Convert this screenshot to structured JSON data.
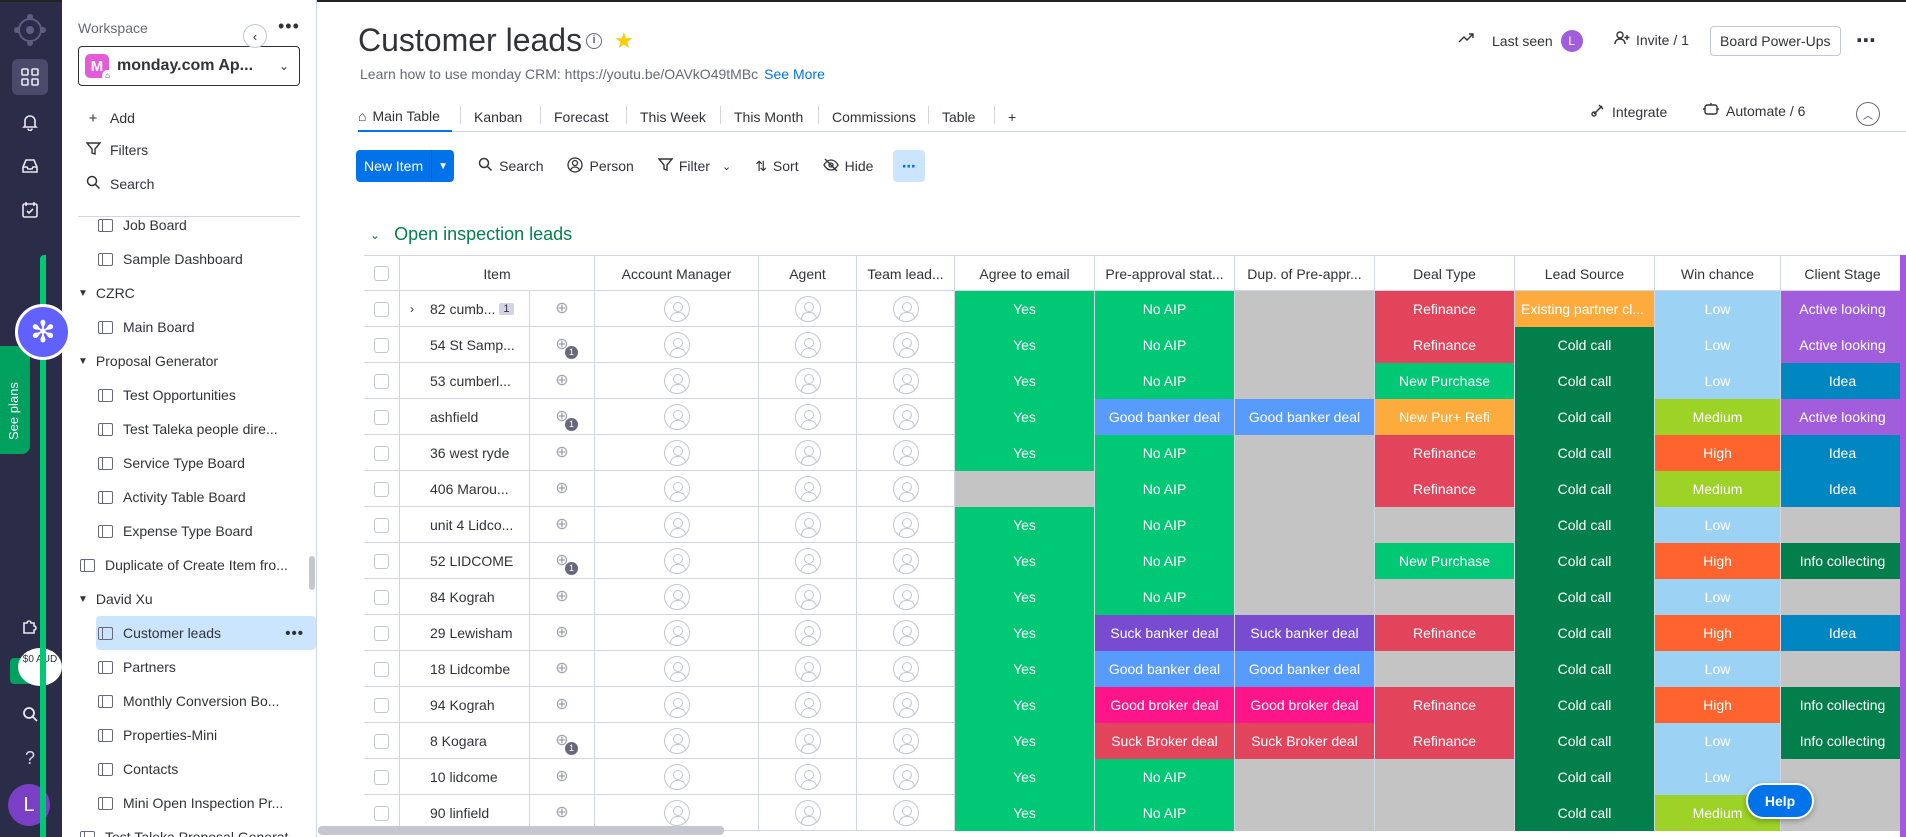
{
  "rail": {
    "icons": [
      "monday-logo-icon",
      "grid-icon",
      "bell-icon",
      "inbox-icon",
      "calendar-check-icon",
      "puzzle-icon",
      "search-icon",
      "help-icon"
    ],
    "wallet_badge": "$0 AUD",
    "avatar": "L"
  },
  "see_plans": "See plans",
  "workspace": {
    "label": "Workspace",
    "badge": "M",
    "name": "monday.com Ap...",
    "actions": {
      "add": "Add",
      "filters": "Filters",
      "search": "Search"
    }
  },
  "tree": [
    {
      "label": "Job Board",
      "type": "board"
    },
    {
      "label": "Sample Dashboard",
      "type": "dashboard"
    },
    {
      "label": "CZRC",
      "type": "folder"
    },
    {
      "label": "Main Board",
      "type": "board"
    },
    {
      "label": "Proposal Generator",
      "type": "folder"
    },
    {
      "label": "Test Opportunities",
      "type": "board"
    },
    {
      "label": "Test Taleka people dire...",
      "type": "board"
    },
    {
      "label": "Service Type Board",
      "type": "board"
    },
    {
      "label": "Activity Table Board",
      "type": "board"
    },
    {
      "label": "Expense Type Board",
      "type": "board"
    },
    {
      "label": "Duplicate of Create Item fro...",
      "type": "board"
    },
    {
      "label": "David Xu",
      "type": "folder"
    },
    {
      "label": "Customer leads",
      "type": "board",
      "selected": true
    },
    {
      "label": "Partners",
      "type": "board"
    },
    {
      "label": "Monthly Conversion Bo...",
      "type": "board"
    },
    {
      "label": "Properties-Mini",
      "type": "board"
    },
    {
      "label": "Contacts",
      "type": "board"
    },
    {
      "label": "Mini Open Inspection Pr...",
      "type": "board"
    },
    {
      "label": "Test Taleka Proposal Generat...",
      "type": "board"
    }
  ],
  "header": {
    "title": "Customer leads",
    "subtitle": "Learn how to use monday CRM: https://youtu.be/OAVkO49tMBc",
    "see_more": "See More",
    "last_seen": "Last seen",
    "last_seen_avatar": "L",
    "invite": "Invite / 1",
    "powerups": "Board Power-Ups"
  },
  "tabs": [
    "Main Table",
    "Kanban",
    "Forecast",
    "This Week",
    "This Month",
    "Commissions",
    "Table",
    "+"
  ],
  "tab_actions": {
    "integrate": "Integrate",
    "automate": "Automate / 6"
  },
  "toolbar": {
    "new_item": "New Item",
    "search": "Search",
    "person": "Person",
    "filter": "Filter",
    "sort": "Sort",
    "hide": "Hide"
  },
  "group": {
    "title": "Open inspection leads",
    "color": "#00c875"
  },
  "columns": [
    "Item",
    "Account Manager",
    "Agent",
    "Team lead...",
    "Agree to email",
    "Pre-approval stat...",
    "Dup. of Pre-appr...",
    "Deal Type",
    "Lead Source",
    "Win chance",
    "Client Stage"
  ],
  "status_colors": {
    "Yes": "#00c875",
    "No AIP": "#00c875",
    "Good banker deal": "#579bfc",
    "Suck banker deal": "#784bd1",
    "Good broker deal": "#ff158a",
    "Suck Broker deal": "#e2445c",
    "Refinance": "#e2445c",
    "New Purchase": "#00c875",
    "New Pur+ Refi": "#fdab3d",
    "Existing partner cl...": "#fdab3d",
    "Cold call": "#037f4c",
    "Low": "#9cd3f5",
    "Medium": "#9cd326",
    "High": "#ff642e",
    "Active looking": "#a25ddc",
    "Idea": "#0086c0",
    "Info collecting": "#037f4c",
    "": "#c4c4c4"
  },
  "rows": [
    {
      "item": "82 cumb...",
      "count": "1",
      "updates": "",
      "agree": "Yes",
      "preapp": "No AIP",
      "dup": "",
      "deal": "Refinance",
      "source": "Existing partner cl...",
      "win": "Low",
      "stage": "Active looking"
    },
    {
      "item": "54 St Samp...",
      "updates": "1",
      "agree": "Yes",
      "preapp": "No AIP",
      "dup": "",
      "deal": "Refinance",
      "source": "Cold call",
      "win": "Low",
      "stage": "Active looking"
    },
    {
      "item": "53 cumberl...",
      "updates": "",
      "agree": "Yes",
      "preapp": "No AIP",
      "dup": "",
      "deal": "New Purchase",
      "source": "Cold call",
      "win": "Low",
      "stage": "Idea"
    },
    {
      "item": "ashfield",
      "updates": "1",
      "agree": "Yes",
      "preapp": "Good banker deal",
      "dup": "Good banker deal",
      "deal": "New Pur+ Refi",
      "source": "Cold call",
      "win": "Medium",
      "stage": "Active looking"
    },
    {
      "item": "36 west ryde",
      "updates": "",
      "agree": "Yes",
      "preapp": "No AIP",
      "dup": "",
      "deal": "Refinance",
      "source": "Cold call",
      "win": "High",
      "stage": "Idea"
    },
    {
      "item": "406 Marou...",
      "updates": "",
      "agree": "",
      "preapp": "No AIP",
      "dup": "",
      "deal": "Refinance",
      "source": "Cold call",
      "win": "Medium",
      "stage": "Idea"
    },
    {
      "item": "unit 4 Lidco...",
      "updates": "",
      "agree": "Yes",
      "preapp": "No AIP",
      "dup": "",
      "deal": "",
      "source": "Cold call",
      "win": "Low",
      "stage": ""
    },
    {
      "item": "52 LIDCOME",
      "updates": "1",
      "agree": "Yes",
      "preapp": "No AIP",
      "dup": "",
      "deal": "New Purchase",
      "source": "Cold call",
      "win": "High",
      "stage": "Info collecting"
    },
    {
      "item": "84 Kograh",
      "updates": "",
      "agree": "Yes",
      "preapp": "No AIP",
      "dup": "",
      "deal": "",
      "source": "Cold call",
      "win": "Low",
      "stage": ""
    },
    {
      "item": "29 Lewisham",
      "updates": "",
      "agree": "Yes",
      "preapp": "Suck banker deal",
      "dup": "Suck banker deal",
      "deal": "Refinance",
      "source": "Cold call",
      "win": "High",
      "stage": "Idea"
    },
    {
      "item": "18 Lidcombe",
      "updates": "",
      "agree": "Yes",
      "preapp": "Good banker deal",
      "dup": "Good banker deal",
      "deal": "",
      "source": "Cold call",
      "win": "Low",
      "stage": ""
    },
    {
      "item": "94 Kograh",
      "updates": "",
      "agree": "Yes",
      "preapp": "Good broker deal",
      "dup": "Good broker deal",
      "deal": "Refinance",
      "source": "Cold call",
      "win": "High",
      "stage": "Info collecting"
    },
    {
      "item": "8 Kogara",
      "updates": "1",
      "agree": "Yes",
      "preapp": "Suck Broker deal",
      "dup": "Suck Broker deal",
      "deal": "Refinance",
      "source": "Cold call",
      "win": "Low",
      "stage": "Info collecting"
    },
    {
      "item": "10 lidcome",
      "updates": "",
      "agree": "Yes",
      "preapp": "No AIP",
      "dup": "",
      "deal": "",
      "source": "Cold call",
      "win": "Low",
      "stage": ""
    },
    {
      "item": "90 linfield",
      "updates": "",
      "agree": "Yes",
      "preapp": "No AIP",
      "dup": "",
      "deal": "",
      "source": "Cold call",
      "win": "Medium",
      "stage": ""
    }
  ],
  "help": "Help"
}
